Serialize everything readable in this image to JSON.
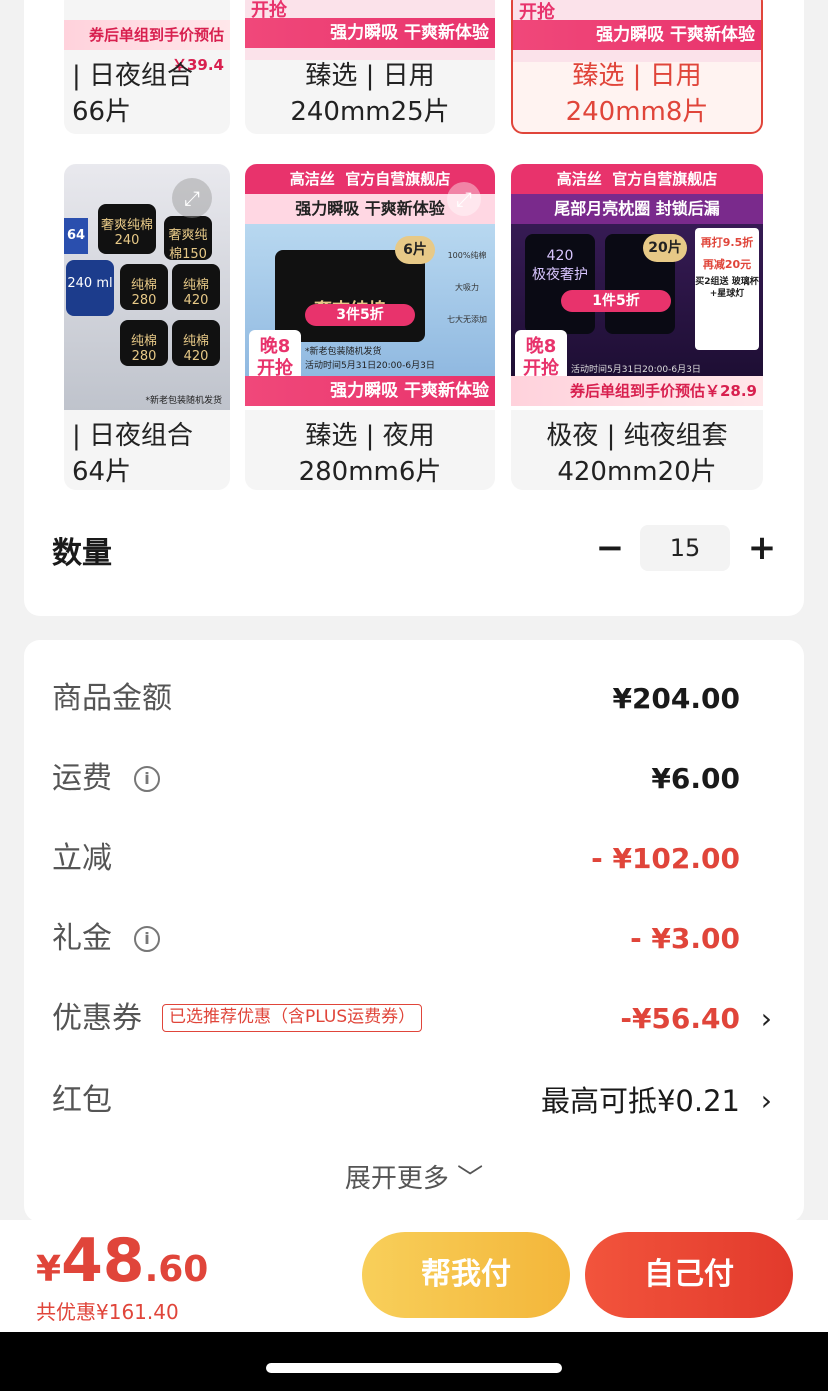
{
  "products_top": [
    {
      "caption1": "| 日夜组合",
      "caption2": "66片",
      "banner": "券后单组到手价预估￥39.4"
    },
    {
      "caption1": "臻选 | 日用",
      "caption2": "240mm25片",
      "banner": "强力瞬吸 干爽新体验",
      "badge": "开抢"
    },
    {
      "caption1": "臻选 | 日用",
      "caption2": "240mm8片",
      "banner": "强力瞬吸 干爽新体验",
      "badge": "开抢"
    }
  ],
  "products_mid": [
    {
      "caption1": "| 日夜组合",
      "caption2": "64片",
      "img_note": "*新老包装随机发货",
      "pill": "64片",
      "pack_labels": [
        "奢爽纯棉240",
        "奢爽纯棉150",
        "纯棉280",
        "纯棉420",
        "240 ml",
        "纯棉280",
        "纯棉420"
      ]
    },
    {
      "caption1": "臻选 | 夜用",
      "caption2": "280mm6片",
      "store": "官方自营旗舰店",
      "brand": "高洁丝",
      "slogan": "强力瞬吸 干爽新体验",
      "promo": "3件5折",
      "pack_count": "6片",
      "pack_name": "奢爽纯棉",
      "features": [
        "100%纯棉",
        "大吸力",
        "七大无添加"
      ],
      "disclaimer": "*新老包装随机发货",
      "period": "活动时间5月31日20:00-6月3日",
      "banner": "强力瞬吸 干爽新体验",
      "badge": "晚8\n开抢"
    },
    {
      "caption1": "极夜 | 纯夜组套",
      "caption2": "420mm20片",
      "store": "官方自营旗舰店",
      "brand": "高洁丝",
      "slogan": "尾部月亮枕圈 封锁后漏",
      "promo": "1件5折",
      "pack_count": "20片",
      "pack_name": "极夜奢护",
      "pack_size": "420",
      "offers": [
        "再打9.5折",
        "再减20元"
      ],
      "gift": "买2组送 玻璃杯+星球灯",
      "period": "活动时间5月31日20:00-6月3日",
      "banner": "券后单组到手价预估￥28.9",
      "badge": "晚8\n开抢"
    }
  ],
  "quantity": {
    "label": "数量",
    "minus": "−",
    "plus": "+",
    "value": "15"
  },
  "details": {
    "goods_amount": {
      "label": "商品金额",
      "value": "¥204.00"
    },
    "shipping": {
      "label": "运费",
      "value": "¥6.00",
      "info": "i"
    },
    "instant_discount": {
      "label": "立减",
      "value": "- ¥102.00"
    },
    "gift_money": {
      "label": "礼金",
      "value": "- ¥3.00",
      "info": "i"
    },
    "coupon": {
      "label": "优惠券",
      "tag": "已选推荐优惠（含PLUS运费券）",
      "value": "-¥56.40",
      "chevron": "›"
    },
    "red_packet": {
      "label": "红包",
      "value": "最高可抵¥0.21",
      "chevron": "›"
    },
    "expand_more": "展开更多 ﹀"
  },
  "bottom": {
    "price_symbol": "¥",
    "price_int": "48",
    "price_dec": ".60",
    "saved": "共优惠¥161.40",
    "help_pay": "帮我付",
    "self_pay": "自己付"
  },
  "colors": {
    "accent": "#e0453a",
    "help_btn": "#f3b63a",
    "pink": "#e8336c"
  }
}
